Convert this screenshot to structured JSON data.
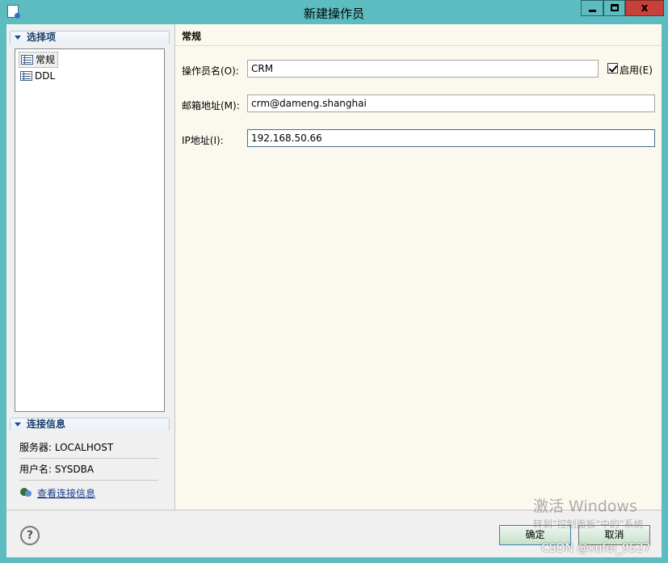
{
  "window": {
    "title": "新建操作员",
    "buttons": {
      "close": "x"
    }
  },
  "left": {
    "options_header": "选择项",
    "tree": [
      {
        "label": "常规",
        "selected": true
      },
      {
        "label": "DDL",
        "selected": false
      }
    ],
    "conn_header": "连接信息",
    "server_line": "服务器: LOCALHOST",
    "user_line": "用户名: SYSDBA",
    "view_link": "查看连接信息"
  },
  "right": {
    "page_title": "常规",
    "fields": {
      "operator_name_label": "操作员名(O):",
      "operator_name_value": "CRM",
      "enabled_label": "启用(E)",
      "enabled_checked": true,
      "email_label": "邮箱地址(M):",
      "email_value": "crm@dameng.shanghai",
      "ip_label": "IP地址(I):",
      "ip_value": "192.168.50.66"
    }
  },
  "footer": {
    "help": "?",
    "ok": "确定",
    "cancel": "取消"
  },
  "watermark": {
    "activate": "激活 Windows",
    "hint": "转到\"控制面板\"中的\"系统",
    "credit": "CSDN @xufei_9527"
  }
}
